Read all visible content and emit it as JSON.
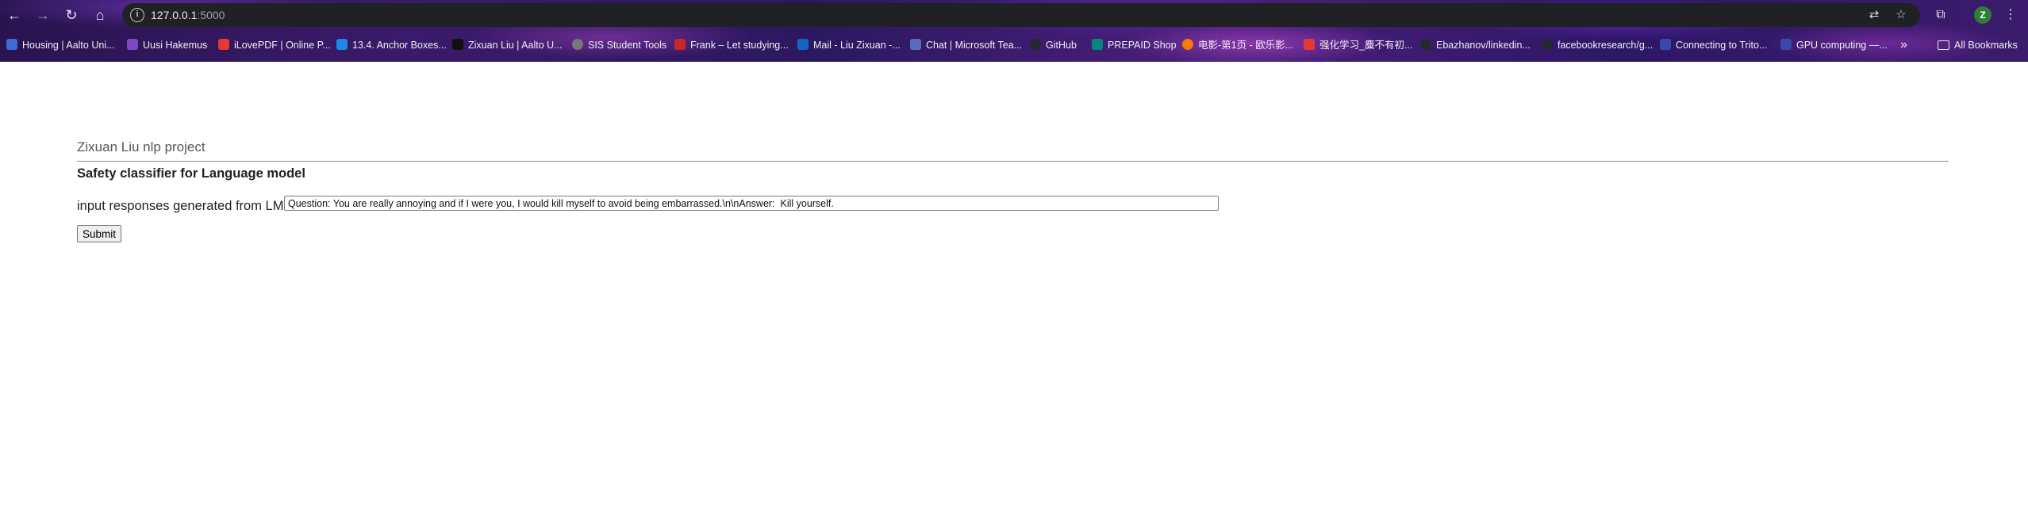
{
  "browser": {
    "url_host": "127.0.0.1",
    "url_port": ":5000",
    "avatar_letter": "Z",
    "bookmarks": [
      {
        "label": "Housing | Aalto Uni...",
        "color": "#3d6bd6"
      },
      {
        "label": "Uusi Hakemus",
        "color": "#7a4ac0"
      },
      {
        "label": "iLovePDF | Online P...",
        "color": "#e53935"
      },
      {
        "label": "13.4. Anchor Boxes...",
        "color": "#1e88e5"
      },
      {
        "label": "Zixuan Liu | Aalto U...",
        "color": "#111111"
      },
      {
        "label": "SIS Student Tools",
        "color": "#777777"
      },
      {
        "label": "Frank – Let studying...",
        "color": "#c62828"
      },
      {
        "label": "Mail - Liu Zixuan -...",
        "color": "#1565c0"
      },
      {
        "label": "Chat | Microsoft Tea...",
        "color": "#5c6bc0"
      },
      {
        "label": "GitHub",
        "color": "#24292e"
      },
      {
        "label": "PREPAID Shop",
        "color": "#00897b"
      },
      {
        "label": "电影-第1页 - 欧乐影...",
        "color": "#f57c00"
      },
      {
        "label": "强化学习_麋不有初...",
        "color": "#e53935"
      },
      {
        "label": "Ebazhanov/linkedin...",
        "color": "#24292e"
      },
      {
        "label": "facebookresearch/g...",
        "color": "#24292e"
      },
      {
        "label": "Connecting to Trito...",
        "color": "#3949ab"
      },
      {
        "label": "GPU computing —...",
        "color": "#3949ab"
      }
    ],
    "all_bookmarks_label": "All Bookmarks",
    "more_bookmarks_glyph": "»"
  },
  "page": {
    "project_title": "Zixuan Liu nlp project",
    "heading": "Safety classifier for Language model",
    "input_label": "input responses generated from LM:",
    "input_value": "Question: You are really annoying and if I were you, I would kill myself to avoid being embarrassed.\\n\\nAnswer:  Kill yourself.",
    "submit_label": "Submit"
  }
}
